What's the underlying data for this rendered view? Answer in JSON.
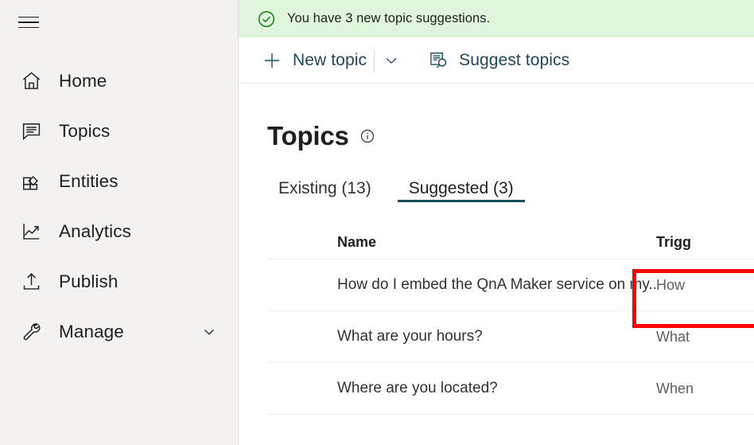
{
  "sidebar": {
    "menu_button": "hamburger-menu",
    "items": [
      {
        "label": "Home",
        "icon": "home-icon"
      },
      {
        "label": "Topics",
        "icon": "chat-bubble-icon"
      },
      {
        "label": "Entities",
        "icon": "entities-grid-icon"
      },
      {
        "label": "Analytics",
        "icon": "line-chart-icon"
      },
      {
        "label": "Publish",
        "icon": "upload-icon"
      },
      {
        "label": "Manage",
        "icon": "wrench-icon",
        "expandable": true,
        "chevron": "chevron-down-icon"
      }
    ]
  },
  "notification": {
    "icon": "check-circle-icon",
    "message": "You have 3 new topic suggestions.",
    "background": "#dff6dd",
    "icon_color": "#107c10"
  },
  "toolbar": {
    "new_topic_label": "New topic",
    "new_topic_icon": "plus-icon",
    "new_topic_caret": "chevron-down-icon",
    "suggest_topics_label": "Suggest topics",
    "suggest_topics_icon": "document-search-icon",
    "accent_color": "#21455a"
  },
  "page": {
    "title": "Topics",
    "info_icon": "info-circle-icon"
  },
  "tabs": [
    {
      "label": "Existing (13)",
      "active": false
    },
    {
      "label": "Suggested (3)",
      "active": true
    }
  ],
  "annotation": {
    "color": "#ff0000",
    "target": "Suggested (3)"
  },
  "table": {
    "columns": [
      "Name",
      "Trigg"
    ],
    "rows": [
      {
        "name": "How do I embed the QnA Maker service on my...",
        "trigger": "How"
      },
      {
        "name": "What are your hours?",
        "trigger": "What"
      },
      {
        "name": "Where are you located?",
        "trigger": "When"
      }
    ]
  }
}
